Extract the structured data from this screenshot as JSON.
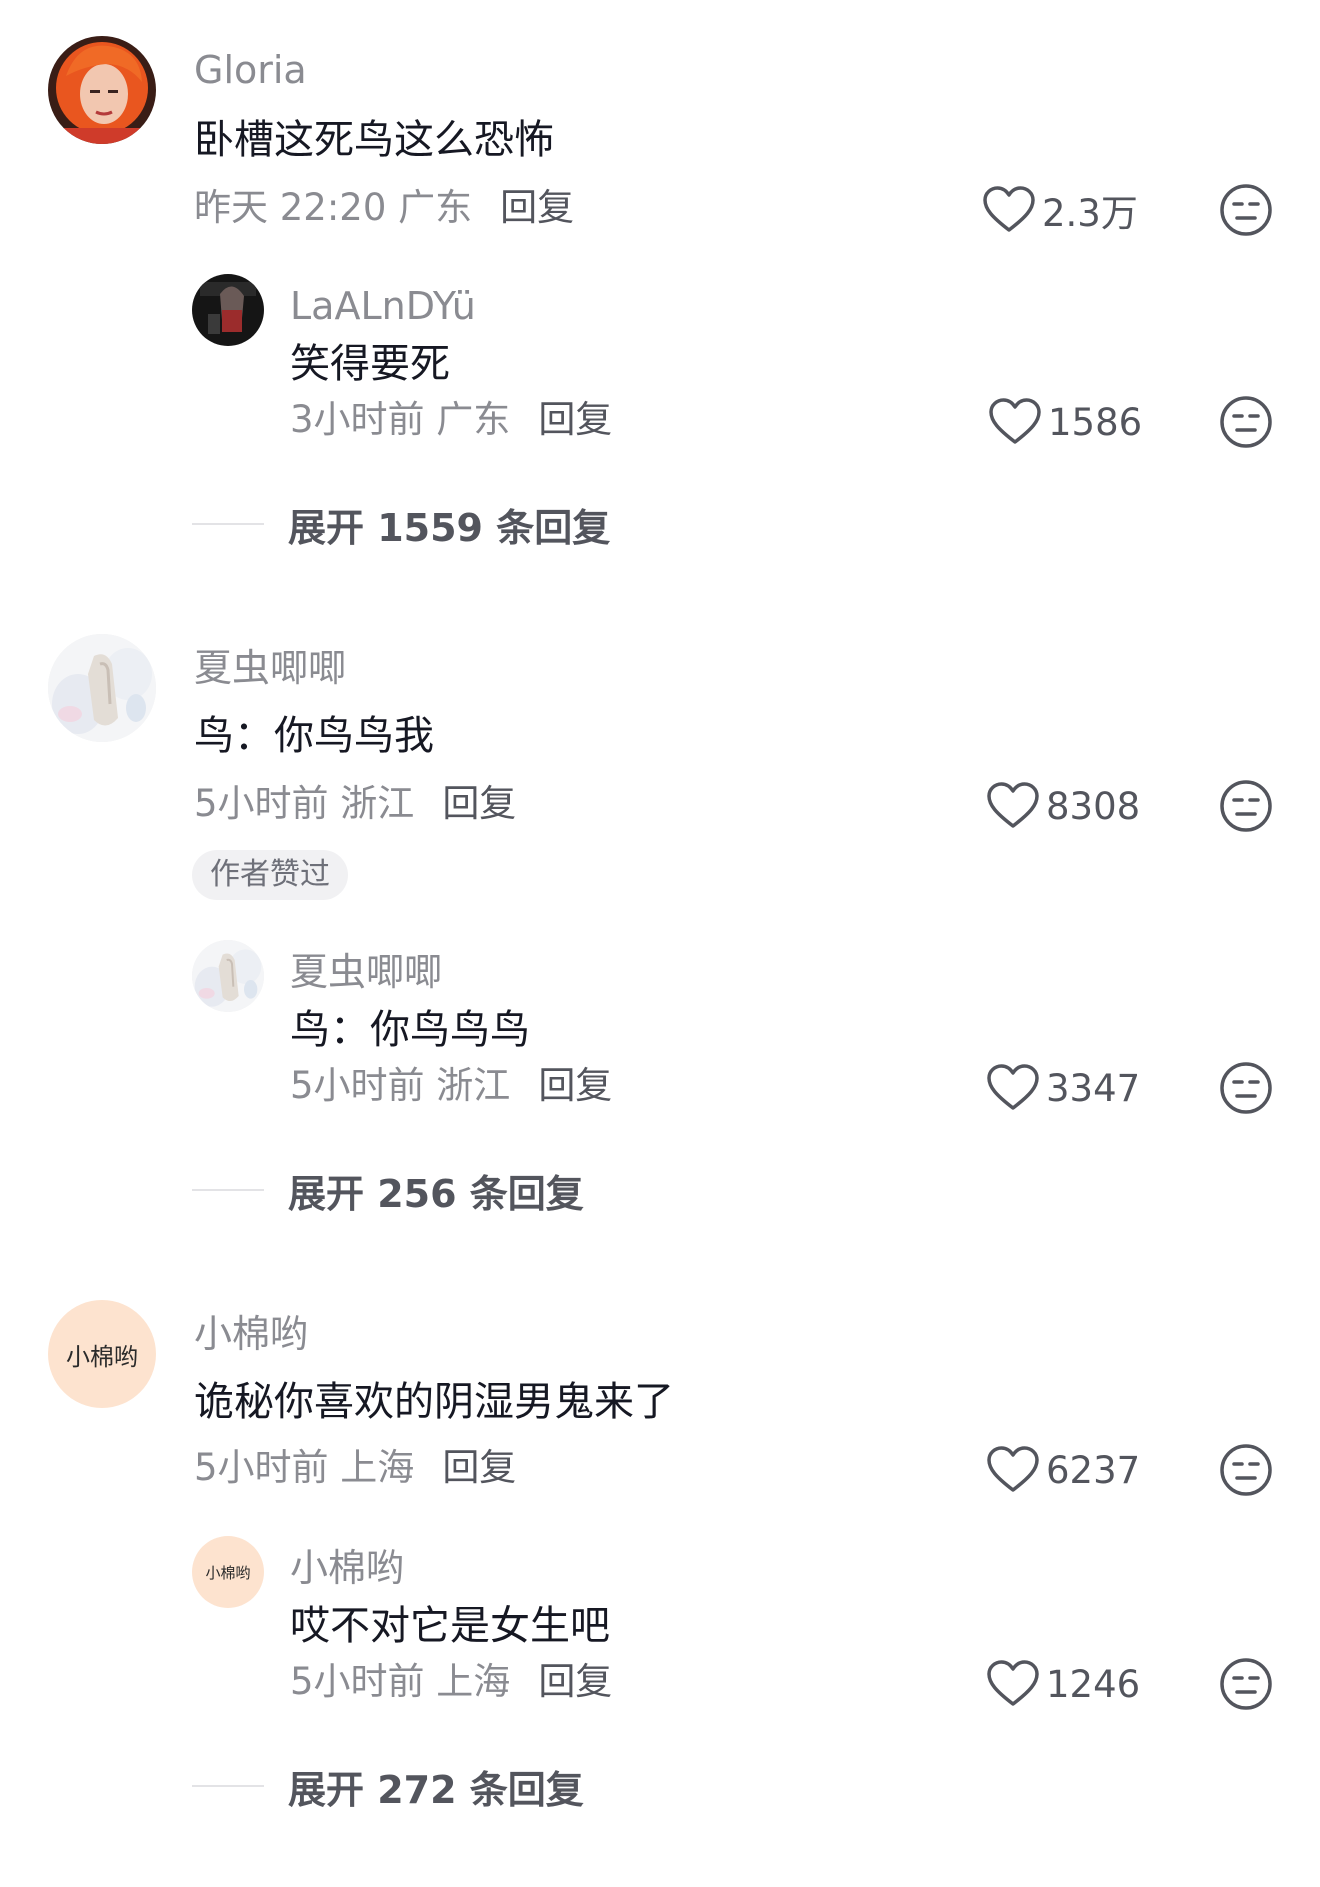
{
  "threads": [
    {
      "comment": {
        "name": "Gloria",
        "text": "卧槽这死鸟这么恐怖",
        "time_location": "昨天 22:20 广东",
        "reply_label": "回复",
        "likes": "2.3万",
        "avatar": "orange-hair-portrait"
      },
      "reply": {
        "name": "LaALnDYü",
        "text": "笑得要死",
        "time_location": "3小时前 广东",
        "reply_label": "回复",
        "likes": "1586",
        "avatar": "dark-figure-photo"
      },
      "expand_label": "展开 1559 条回复"
    },
    {
      "comment": {
        "name": "夏虫唧唧",
        "text": "鸟：你鸟鸟我",
        "time_location": "5小时前 浙江",
        "reply_label": "回复",
        "likes": "8308",
        "author_badge": "作者赞过",
        "avatar": "pale-watercolor-figure"
      },
      "reply": {
        "name": "夏虫唧唧",
        "text": "鸟：你鸟鸟鸟",
        "time_location": "5小时前 浙江",
        "reply_label": "回复",
        "likes": "3347",
        "avatar": "pale-watercolor-figure"
      },
      "expand_label": "展开 256 条回复"
    },
    {
      "comment": {
        "name": "小棉哟",
        "text": "诡秘你喜欢的阴湿男鬼来了",
        "time_location": "5小时前 上海",
        "reply_label": "回复",
        "likes": "6237",
        "avatar_text": "小棉哟"
      },
      "reply": {
        "name": "小棉哟",
        "text": "哎不对它是女生吧",
        "time_location": "5小时前 上海",
        "reply_label": "回复",
        "likes": "1246",
        "avatar_text": "小棉哟"
      },
      "expand_label": "展开 272 条回复"
    }
  ],
  "icons": {
    "like": "heart-outline-icon",
    "dislike": "meh-face-icon"
  },
  "colors": {
    "name": "#8a8b91",
    "text": "#161823",
    "secondary": "#53555d",
    "avatar_peach": "#fde3cf"
  }
}
